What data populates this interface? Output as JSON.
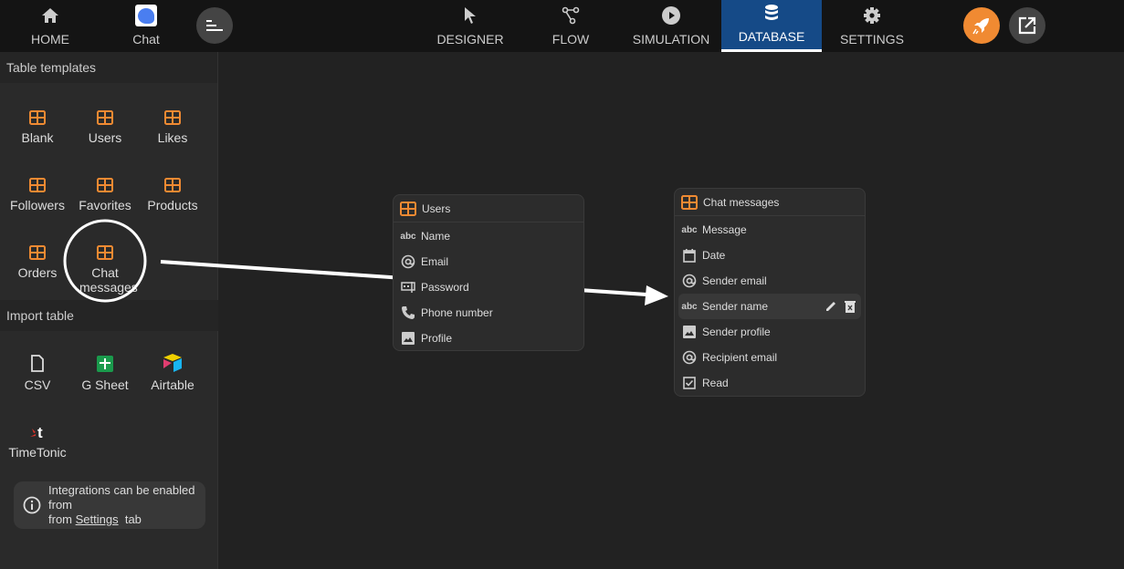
{
  "topbar": {
    "home": "HOME",
    "chat": "Chat",
    "tabs": [
      "DESIGNER",
      "FLOW",
      "SIMULATION",
      "DATABASE",
      "SETTINGS"
    ],
    "active_tab": "DATABASE"
  },
  "sidebar": {
    "templates_title": "Table templates",
    "templates": [
      "Blank",
      "Users",
      "Likes",
      "Followers",
      "Favorites",
      "Products",
      "Orders",
      "Chat messages"
    ],
    "import_title": "Import table",
    "imports": [
      "CSV",
      "G Sheet",
      "Airtable",
      "TimeTonic"
    ],
    "info_text": "Integrations can be enabled from",
    "info_link": "Settings",
    "info_tail": "tab"
  },
  "canvas": {
    "users_table": {
      "title": "Users",
      "fields": [
        {
          "type": "text",
          "name": "Name"
        },
        {
          "type": "email",
          "name": "Email"
        },
        {
          "type": "password",
          "name": "Password"
        },
        {
          "type": "phone",
          "name": "Phone number"
        },
        {
          "type": "image",
          "name": "Profile"
        }
      ]
    },
    "chat_table": {
      "title": "Chat messages",
      "fields": [
        {
          "type": "text",
          "name": "Message"
        },
        {
          "type": "date",
          "name": "Date"
        },
        {
          "type": "email",
          "name": "Sender email"
        },
        {
          "type": "text",
          "name": "Sender name"
        },
        {
          "type": "image",
          "name": "Sender profile"
        },
        {
          "type": "email",
          "name": "Recipient email"
        },
        {
          "type": "boolean",
          "name": "Read"
        }
      ]
    }
  },
  "colors": {
    "accent": "#f08a32",
    "active_tab": "#154a87"
  }
}
